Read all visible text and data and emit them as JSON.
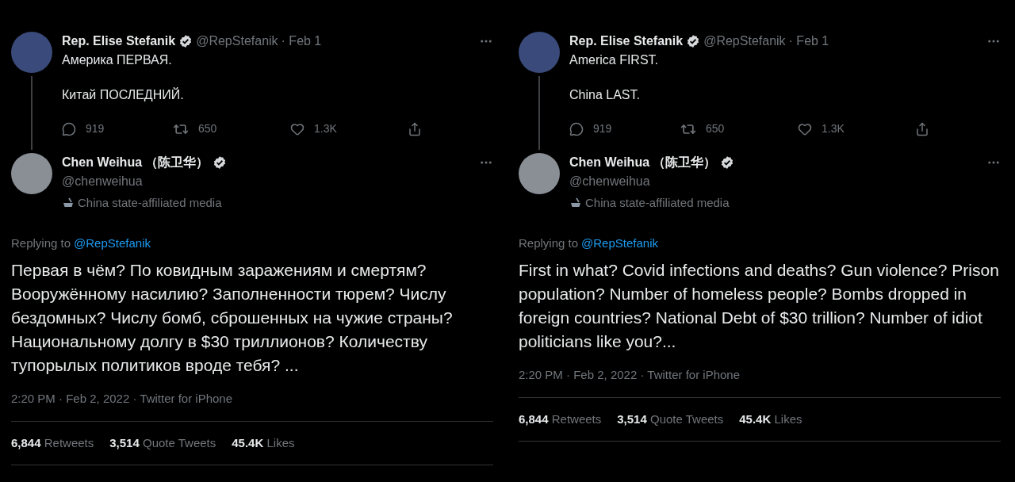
{
  "panels": [
    {
      "parent": {
        "name": "Rep. Elise Stefanik",
        "handle": "@RepStefanik",
        "date": "· Feb 1",
        "paragraphs": [
          "Америка ПЕРВАЯ.",
          "Китай ПОСЛЕДНИЙ."
        ],
        "replies": "919",
        "retweets": "650",
        "likes": "1.3K"
      },
      "reply": {
        "name": "Chen Weihua （陈卫华）",
        "handle": "@chenweihua",
        "label": "China state-affiliated media",
        "replying_prefix": "Replying to",
        "replying_handle": "@RepStefanik",
        "body": "Первая в чём? По ковидным заражениям и смертям? Вооружённому насилию? Заполненности тюрем? Числу бездомных? Числу бомб, сброшенных на чужие страны? Национальному долгу в $30 триллионов? Количеству тупорылых политиков вроде тебя? ...",
        "meta": "2:20 PM · Feb 2, 2022 · Twitter for iPhone",
        "stats": [
          {
            "count": "6,844",
            "label": "Retweets"
          },
          {
            "count": "3,514",
            "label": "Quote Tweets"
          },
          {
            "count": "45.4K",
            "label": "Likes"
          }
        ]
      }
    },
    {
      "parent": {
        "name": "Rep. Elise Stefanik",
        "handle": "@RepStefanik",
        "date": "· Feb 1",
        "paragraphs": [
          "America FIRST.",
          "China LAST."
        ],
        "replies": "919",
        "retweets": "650",
        "likes": "1.3K"
      },
      "reply": {
        "name": "Chen Weihua （陈卫华）",
        "handle": "@chenweihua",
        "label": "China state-affiliated media",
        "replying_prefix": "Replying to",
        "replying_handle": "@RepStefanik",
        "body": "First in what? Covid infections and deaths? Gun violence? Prison population? Number of homeless people? Bombs dropped in foreign countries? National Debt of $30 trillion? Number of idiot politicians like you?...",
        "meta": "2:20 PM · Feb 2, 2022 · Twitter for iPhone",
        "stats": [
          {
            "count": "6,844",
            "label": "Retweets"
          },
          {
            "count": "3,514",
            "label": "Quote Tweets"
          },
          {
            "count": "45.4K",
            "label": "Likes"
          }
        ]
      }
    }
  ]
}
